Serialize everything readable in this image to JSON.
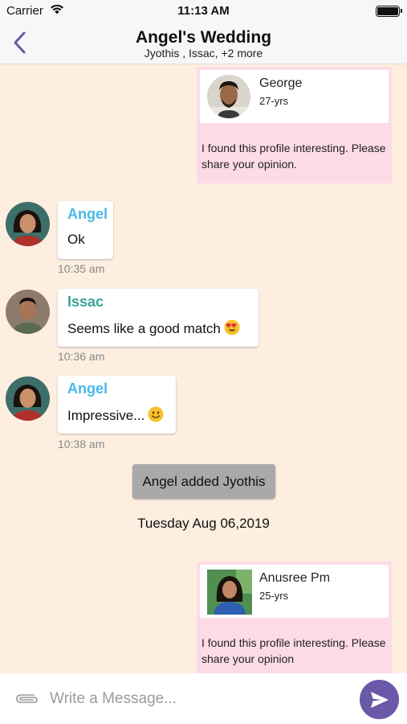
{
  "status_bar": {
    "carrier": "Carrier",
    "time": "11:13 AM"
  },
  "header": {
    "title": "Angel's Wedding",
    "subtitle": "Jyothis , Issac, +2 more"
  },
  "cards": [
    {
      "name": "George",
      "age": "27-yrs",
      "message": "I found this profile interesting. Please share your opinion."
    },
    {
      "name": "Anusree Pm",
      "age": "25-yrs",
      "message": "I found this profile interesting. Please share your opinion"
    }
  ],
  "messages": [
    {
      "sender": "Angel",
      "text": "Ok",
      "time": "10:35 am",
      "sender_color": "#4ab8e8"
    },
    {
      "sender": "Issac",
      "text": "Seems like a good match",
      "emoji": "heart-eyes-emoji",
      "time": "10:36 am",
      "sender_color": "#3aa59a"
    },
    {
      "sender": "Angel",
      "text": "Impressive...",
      "emoji": "smile-emoji",
      "time": "10:38 am",
      "sender_color": "#4ab8e8"
    }
  ],
  "system_message": "Angel added Jyothis",
  "date_separator": "Tuesday Aug 06,2019",
  "composer": {
    "placeholder": "Write a Message...",
    "send_icon": "send-icon",
    "attach_icon": "paperclip-icon"
  },
  "colors": {
    "accent": "#6a59a8",
    "background": "#fdeee0",
    "card": "#fcdbe6"
  }
}
